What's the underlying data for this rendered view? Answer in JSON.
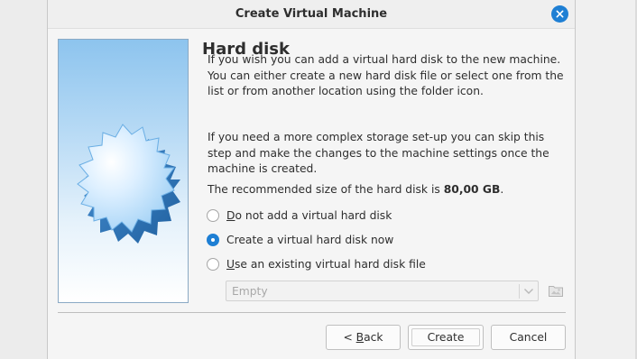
{
  "window": {
    "title": "Create Virtual Machine",
    "close_icon": "close-icon"
  },
  "page": {
    "title": "Hard disk",
    "para1": "If you wish you can add a virtual hard disk to the new machine. You can either create a new hard disk file or select one from the list or from another location using the folder icon.",
    "para2": "If you need a more complex storage set-up you can skip this step and make the changes to the machine settings once the machine is created.",
    "para3_prefix": "The recommended size of the hard disk is ",
    "para3_size": "80,00 GB",
    "para3_suffix": "."
  },
  "options": [
    {
      "mnemonic": "D",
      "rest": "o not add a virtual hard disk",
      "checked": false
    },
    {
      "mnemonic": "",
      "label": "Create a virtual hard disk now",
      "checked": true
    },
    {
      "mnemonic": "U",
      "rest": "se an existing virtual hard disk file",
      "checked": false
    }
  ],
  "existing_disk": {
    "selected": "Empty",
    "enabled": false
  },
  "buttons": {
    "back_prefix": "< ",
    "back_mnemonic": "B",
    "back_rest": "ack",
    "create": "Create",
    "cancel": "Cancel"
  },
  "colors": {
    "accent": "#1e7fd4",
    "text": "#2e2e2e",
    "disabled_text": "#a8a8a8"
  }
}
